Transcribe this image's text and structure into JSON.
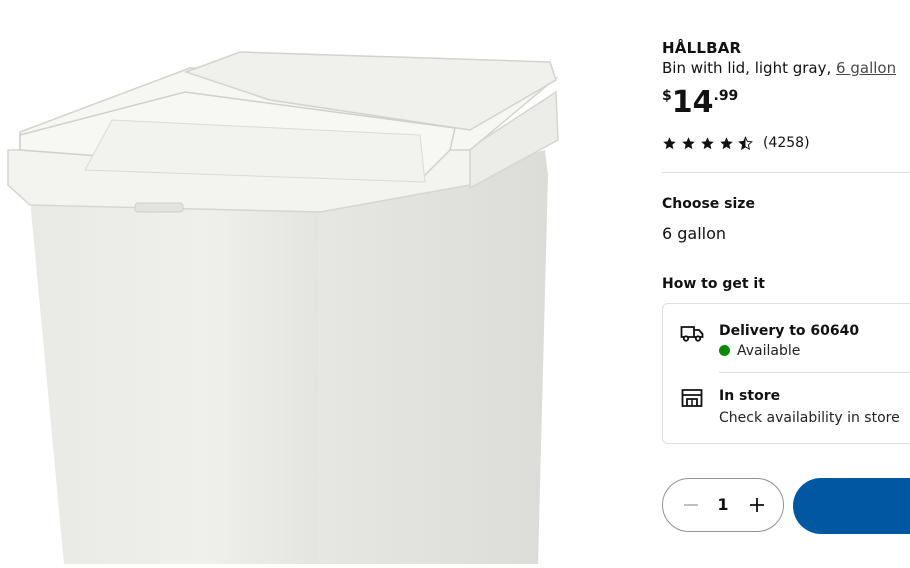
{
  "product": {
    "name": "HÅLLBAR",
    "description_prefix": "Bin with lid, light gray,",
    "size_link": "6 gallon",
    "price": {
      "currency": "$",
      "whole": "14",
      "cents": ".99"
    },
    "rating": {
      "stars": 4.5,
      "count": "(4258)"
    }
  },
  "size_section": {
    "heading": "Choose size",
    "value": "6 gallon"
  },
  "fulfilment": {
    "heading": "How to get it",
    "delivery": {
      "title": "Delivery to 60640",
      "status": "Available",
      "icon": "truck-icon",
      "status_color": "#0a8a00"
    },
    "store": {
      "title": "In store",
      "subtitle": "Check availability in store",
      "icon": "store-icon"
    }
  },
  "quantity": {
    "value": "1"
  },
  "colors": {
    "accent": "#0058a3",
    "background": "#ffffff"
  }
}
